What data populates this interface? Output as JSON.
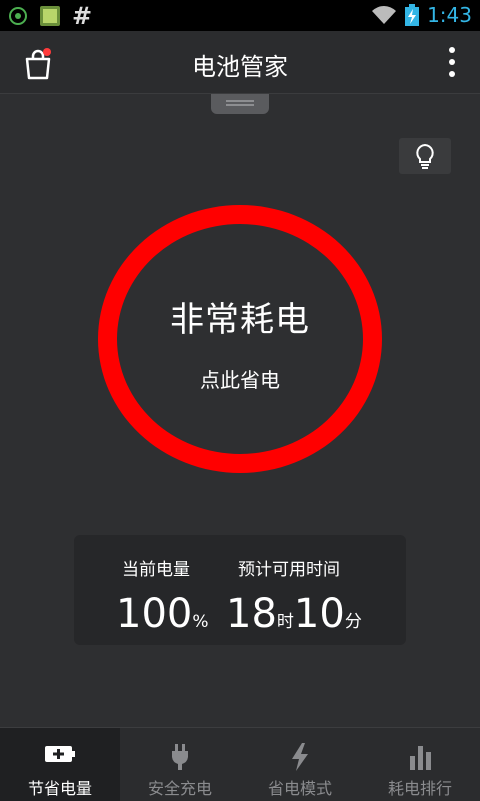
{
  "status_bar": {
    "time": "1:43",
    "notification_symbol": "#"
  },
  "header": {
    "title": "电池管家"
  },
  "main": {
    "status_title": "非常耗电",
    "save_action": "点此省电",
    "ring_color": "#ff0000"
  },
  "info": {
    "current_label": "当前电量",
    "current_value": "100",
    "current_unit": "%",
    "remaining_label": "预计可用时间",
    "hours_value": "18",
    "hours_unit": "时",
    "minutes_value": "10",
    "minutes_unit": "分"
  },
  "bottom_nav": {
    "tabs": [
      {
        "label": "节省电量",
        "icon": "battery-plus-icon"
      },
      {
        "label": "安全充电",
        "icon": "plug-icon"
      },
      {
        "label": "省电模式",
        "icon": "lightning-icon"
      },
      {
        "label": "耗电排行",
        "icon": "bar-chart-icon"
      }
    ]
  }
}
